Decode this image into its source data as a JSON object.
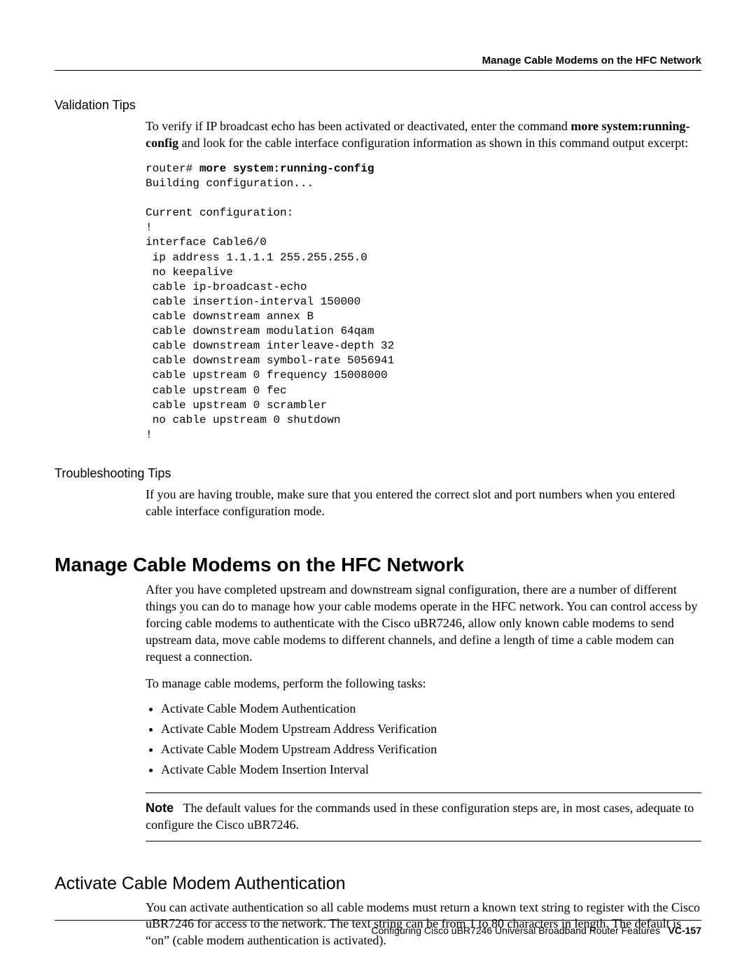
{
  "header": {
    "running_title": "Manage Cable Modems on the HFC Network"
  },
  "section1": {
    "heading": "Validation Tips",
    "para_parts": {
      "pre": "To verify if IP broadcast echo has been activated or deactivated, enter the command ",
      "cmd1": "more system:running-config",
      "mid": " and look for the cable interface configuration information as shown in this command output excerpt:"
    },
    "code_prompt": "router# ",
    "code_cmd": "more system:running-config",
    "code_body": "Building configuration...\n\nCurrent configuration:\n!\ninterface Cable6/0\n ip address 1.1.1.1 255.255.255.0\n no keepalive\n cable ip-broadcast-echo\n cable insertion-interval 150000\n cable downstream annex B\n cable downstream modulation 64qam\n cable downstream interleave-depth 32\n cable downstream symbol-rate 5056941\n cable upstream 0 frequency 15008000\n cable upstream 0 fec\n cable upstream 0 scrambler\n no cable upstream 0 shutdown\n!"
  },
  "section2": {
    "heading": "Troubleshooting Tips",
    "para": "If you are having trouble, make sure that you entered the correct slot and port numbers when you entered cable interface configuration mode."
  },
  "section3": {
    "heading": "Manage Cable Modems on the HFC Network",
    "para1": "After you have completed upstream and downstream signal configuration, there are a number of different things you can do to manage how your cable modems operate in the HFC network. You can control access by forcing cable modems to authenticate with the Cisco uBR7246, allow only known cable modems to send upstream data, move cable modems to different channels, and define a length of time a cable modem can request a connection.",
    "para2": "To manage cable modems, perform the following tasks:",
    "bullets": [
      "Activate Cable Modem Authentication",
      "Activate Cable Modem Upstream Address Verification",
      "Activate Cable Modem Upstream Address Verification",
      "Activate Cable Modem Insertion Interval"
    ],
    "note_label": "Note",
    "note_body": "The default values for the commands used in these configuration steps are, in most cases, adequate to configure the Cisco uBR7246."
  },
  "section4": {
    "heading": "Activate Cable Modem Authentication",
    "para": "You can activate authentication so all cable modems must return a known text string to register with the Cisco uBR7246 for access to the network. The text string can be from 1 to 80 characters in length. The default is “on” (cable modem authentication is activated)."
  },
  "footer": {
    "doc_title": "Configuring Cisco uBR7246 Universal Broadband Router Features",
    "page_label": "VC-157"
  }
}
